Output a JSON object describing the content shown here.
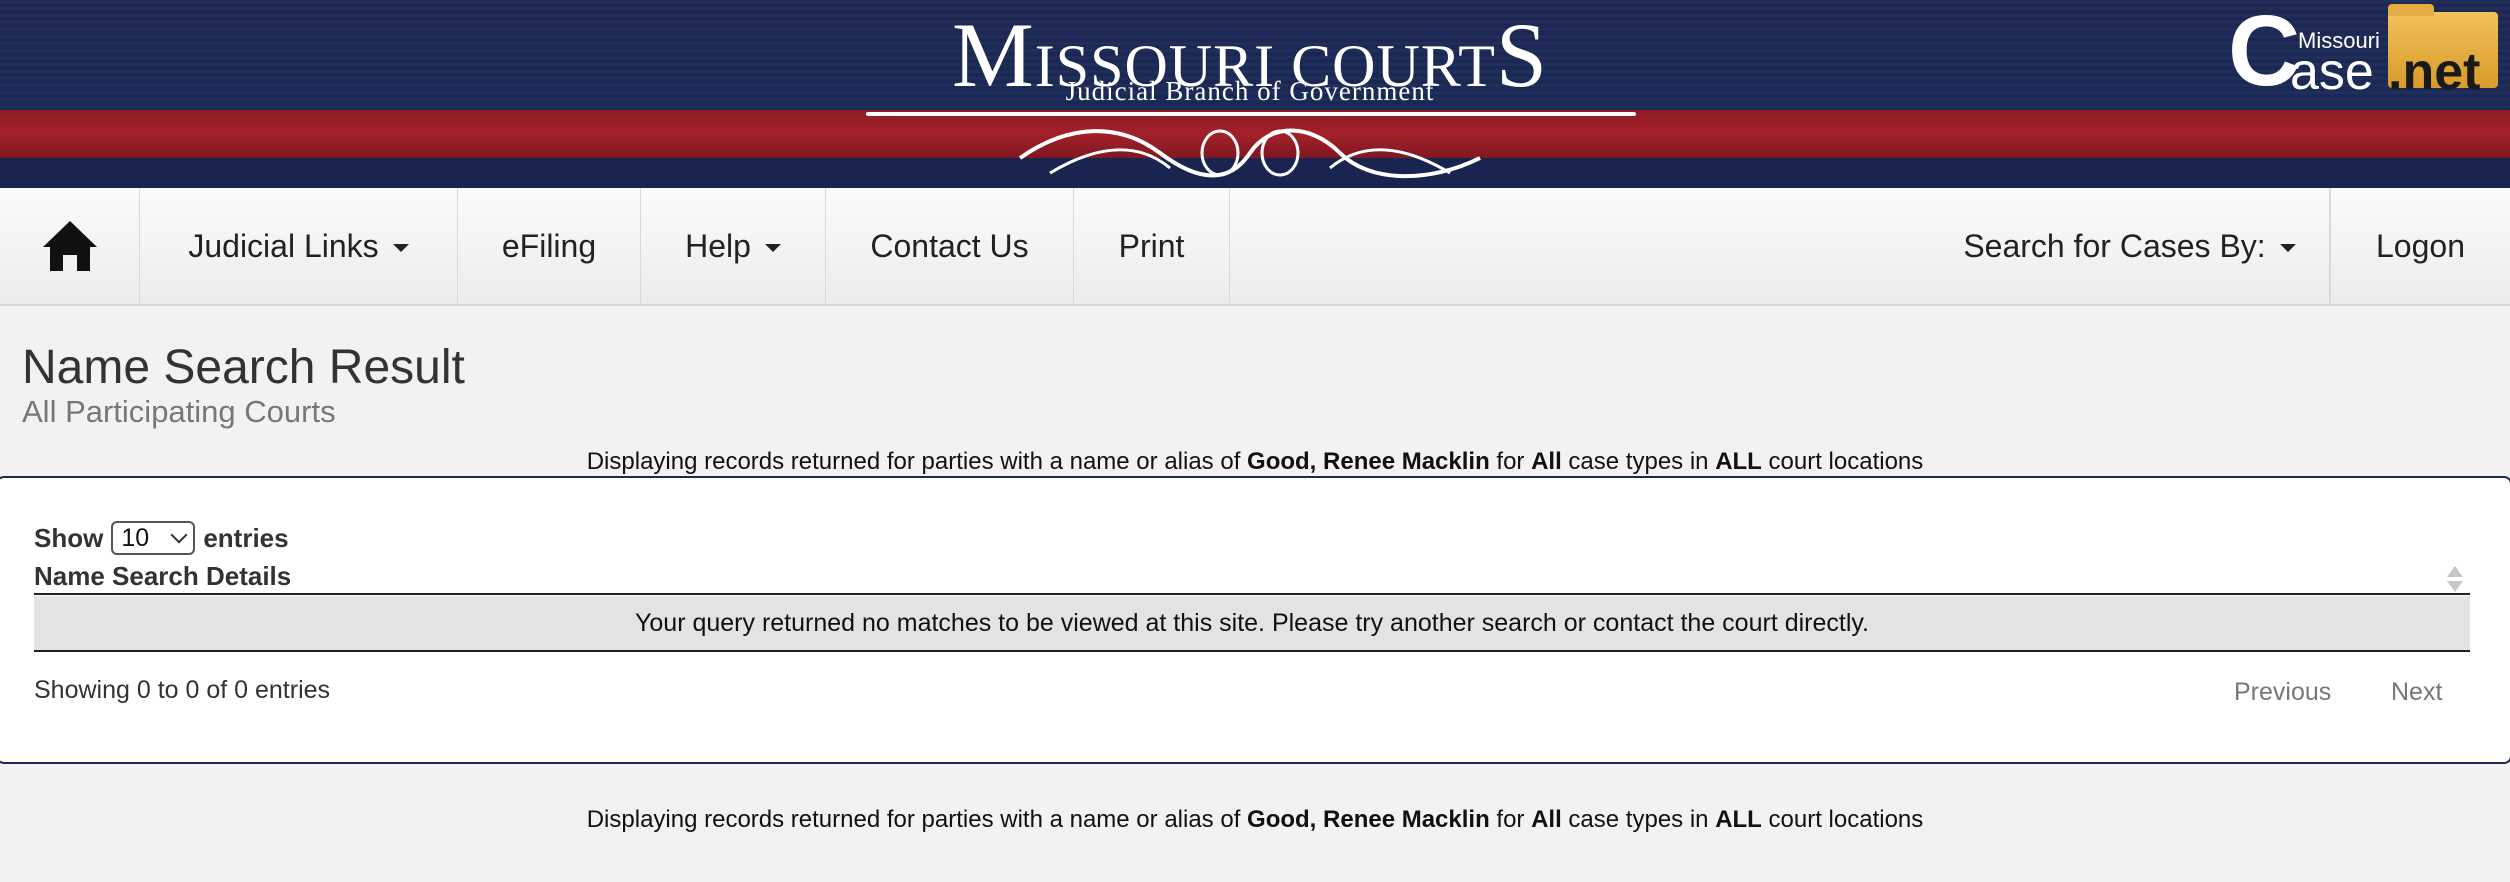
{
  "banner": {
    "title_initial": "M",
    "title_rest": "ISSOURI COURT",
    "title_final": "S",
    "subtitle": "Judicial Branch of Government",
    "casenet_c": "C",
    "casenet_missouri": "Missouri",
    "casenet_ase": "ase",
    "casenet_net": ".net"
  },
  "nav": {
    "home_icon": "home-icon",
    "judicial_links": "Judicial Links",
    "efiling": "eFiling",
    "help": "Help",
    "contact_us": "Contact Us",
    "print": "Print",
    "search_for_cases": "Search for Cases By:",
    "logon": "Logon"
  },
  "page": {
    "title": "Name Search Result",
    "subtitle": "All Participating Courts"
  },
  "info": {
    "prefix": "Displaying records returned for parties with a name or alias of ",
    "name": "Good, Renee Macklin",
    "mid1": " for ",
    "case_types": "All",
    "mid2": " case types in ",
    "locations": "ALL",
    "suffix": " court locations"
  },
  "table": {
    "show_label": "Show",
    "entries_value": "10",
    "entries_label": "entries",
    "column_header": "Name Search Details",
    "empty_message": "Your query returned no matches to be viewed at this site. Please try another search or contact the court directly.",
    "showing_text": "Showing 0 to 0 of 0 entries",
    "previous": "Previous",
    "next": "Next"
  }
}
